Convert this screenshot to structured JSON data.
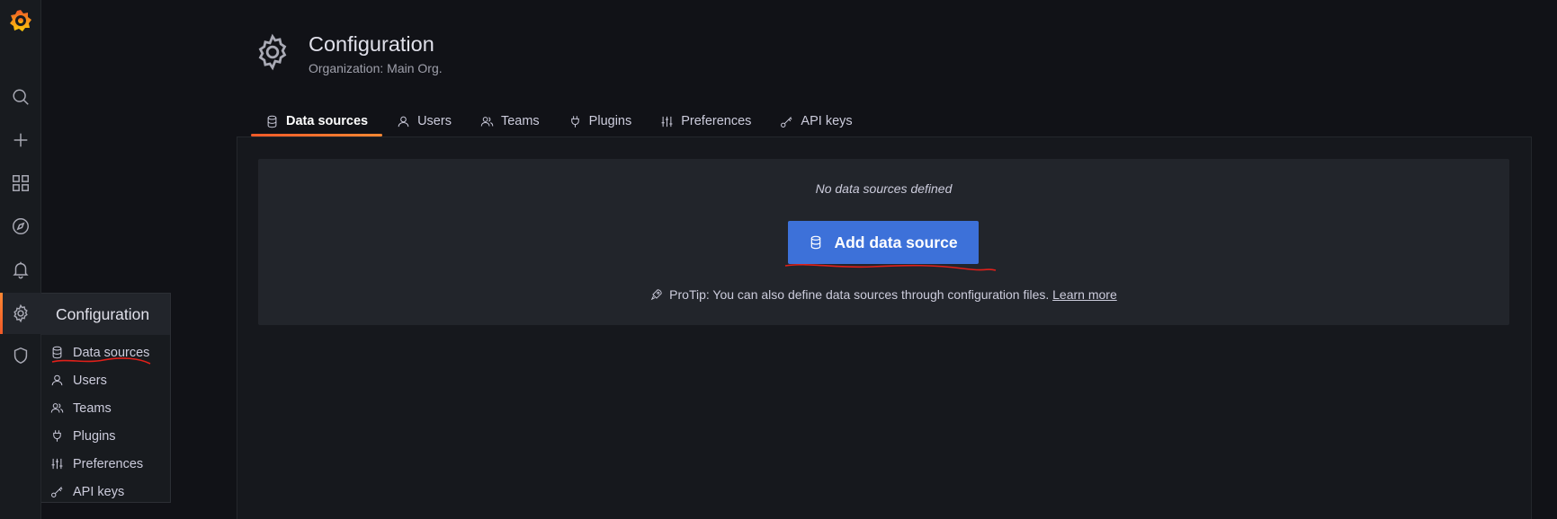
{
  "header": {
    "title": "Configuration",
    "subtitle": "Organization: Main Org."
  },
  "tabs": [
    {
      "label": "Data sources",
      "icon": "database-icon",
      "active": true
    },
    {
      "label": "Users",
      "icon": "user-icon"
    },
    {
      "label": "Teams",
      "icon": "users-icon"
    },
    {
      "label": "Plugins",
      "icon": "plug-icon"
    },
    {
      "label": "Preferences",
      "icon": "sliders-icon"
    },
    {
      "label": "API keys",
      "icon": "key-icon"
    }
  ],
  "sidebar": {
    "icons": [
      "grafana-logo",
      "search-icon",
      "plus-icon",
      "dashboards-icon",
      "explore-icon",
      "alert-bell-icon",
      "gear-icon",
      "shield-icon"
    ],
    "active": "gear-icon"
  },
  "flyout": {
    "title": "Configuration",
    "items": [
      {
        "label": "Data sources",
        "icon": "database-icon"
      },
      {
        "label": "Users",
        "icon": "user-icon"
      },
      {
        "label": "Teams",
        "icon": "users-icon"
      },
      {
        "label": "Plugins",
        "icon": "plug-icon"
      },
      {
        "label": "Preferences",
        "icon": "sliders-icon"
      },
      {
        "label": "API keys",
        "icon": "key-icon"
      }
    ]
  },
  "empty_state": {
    "title": "No data sources defined",
    "button_label": "Add data source",
    "protip": "ProTip: You can also define data sources through configuration files.",
    "learn_more": "Learn more"
  },
  "colors": {
    "accent_orange": "#f05a28",
    "primary_button": "#3d71d9",
    "annotation_red": "#e0201a"
  }
}
